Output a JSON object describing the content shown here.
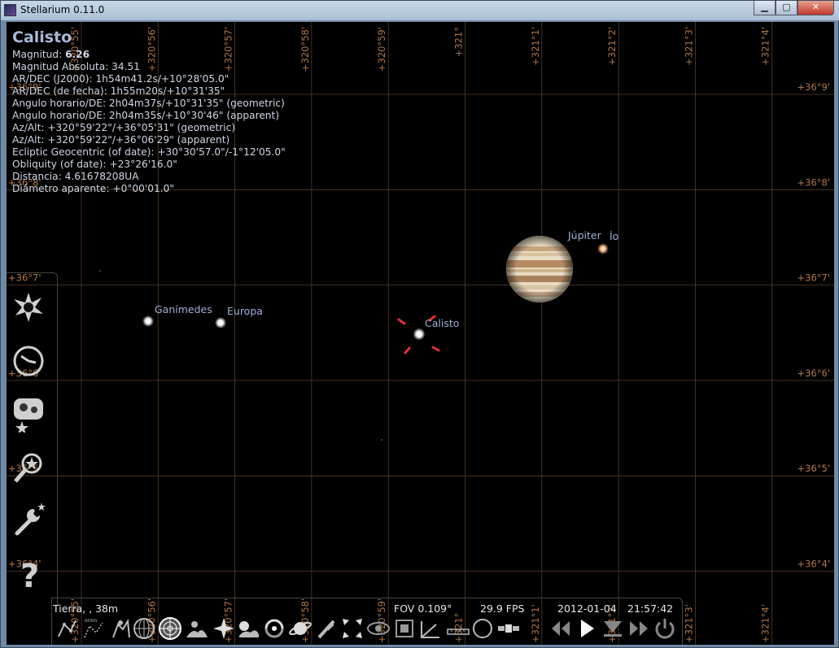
{
  "window": {
    "title": "Stellarium 0.11.0",
    "minimize_glyph": "▁",
    "maximize_glyph": "▢",
    "close_glyph": "✕"
  },
  "info": {
    "title": "Calisto",
    "magnitude_label": "Magnitud: ",
    "magnitude_value": "6.26",
    "lines": [
      "Magnitud Absoluta: 34.51",
      "AR/DEC (J2000): 1h54m41.2s/+10°28'05.0\"",
      "AR/DEC (de fecha): 1h55m20s/+10°31'35\"",
      "Angulo horario/DE: 2h04m37s/+10°31'35\" (geometric)",
      "Angulo horario/DE: 2h04m35s/+10°30'46\" (apparent)",
      "Az/Alt: +320°59'22\"/+36°05'31\" (geometric)",
      "Az/Alt: +320°59'22\"/+36°06'29\" (apparent)",
      "Ecliptic Geocentric (of date): +30°30'57.0\"/-1°12'05.0\"",
      "Obliquity (of date): +23°26'16.0\"",
      "Distancia: 4.61678208UA",
      "Diámetro aparente: +0°00'01.0\""
    ]
  },
  "grid": {
    "az_top_labels": [
      "+320°55'",
      "+320°56'",
      "+320°57'",
      "+320°58'",
      "+320°59'",
      "+321°",
      "+321°1'",
      "+321°2'",
      "+321°3'",
      "+321°4'"
    ],
    "az_bottom_labels": [
      "+320°55'",
      "+320°56'",
      "+320°57'",
      "+320°58'",
      "+320°59'",
      "+321°",
      "+321°1'",
      "+321°2'",
      "+321°3'",
      "+321°4'"
    ],
    "alt_right_labels": [
      "+36°9'",
      "+36°8'",
      "+36°7'",
      "+36°6'",
      "+36°5'",
      "+36°4'"
    ],
    "alt_left_labels": [
      "+36°9'",
      "+36°8'",
      "+36°7'",
      "+36°6'",
      "+36°5'",
      "+36°4'"
    ],
    "line_color": "#5a3d28",
    "label_color": "#b07848"
  },
  "objects": {
    "jupiter": "Júpiter",
    "io": "Ío",
    "ganymede": "Ganímedes",
    "europa": "Europa",
    "callisto": "Calisto"
  },
  "status": {
    "location": "Tierra, , 38m",
    "fov": "FOV 0.109°",
    "fps": "29.9 FPS",
    "date": "2012-01-04",
    "time": "21:57:42"
  },
  "toolbar": {
    "orion_label": "orion",
    "icons": [
      "constellation-lines-icon",
      "constellation-labels-icon",
      "constellation-art-icon",
      "equatorial-grid-icon",
      "azimuthal-grid-icon",
      "ground-icon",
      "cardinal-points-icon",
      "atmosphere-icon",
      "nebulas-icon",
      "planet-labels-icon",
      "equatorial-mount-icon",
      "center-object-icon",
      "night-mode-icon",
      "fullscreen-icon",
      "angle-measure-icon",
      "ruler-icon",
      "ocular-icon",
      "satellite-icon",
      "slower-time-icon",
      "play-time-icon",
      "now-time-icon",
      "faster-time-icon",
      "quit-icon"
    ]
  },
  "colors": {
    "info_text": "#cfd6e6",
    "label_text": "#9fb0d4",
    "marker": "#e03030"
  }
}
